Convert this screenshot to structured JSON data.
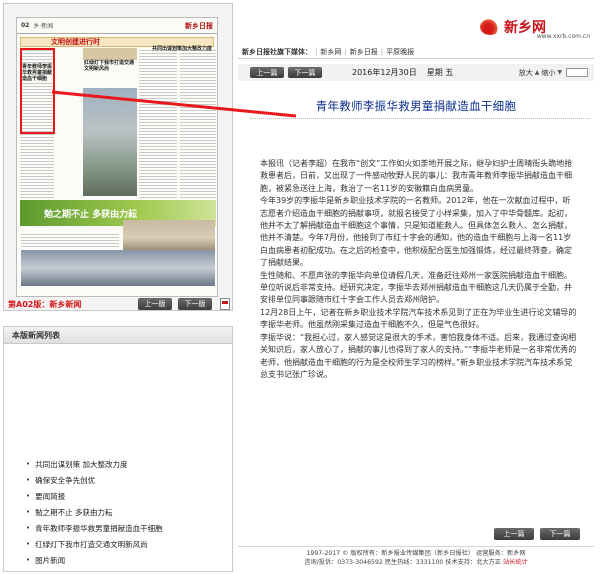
{
  "header": {
    "logo_name": "新乡网",
    "logo_url": "www.xxrb.com.cn"
  },
  "nav": {
    "lead": "新乡日报社旗下媒体：",
    "links": [
      "新乡网",
      "新乡日报",
      "平原晚报"
    ]
  },
  "toolbar": {
    "prev_label": "上一篇",
    "next_label": "下一篇",
    "date": "2016年12月30日",
    "weekday": "星期 五",
    "zoom_in": "放大",
    "zoom_out": "缩小"
  },
  "article": {
    "title": "青年教师李振华救男童捐献造血干细胞",
    "paragraphs": [
      "本报讯（记者李超）在我市“创文”工作如火如荼地开展之际，继孕妇护士周晴街头跪地抢救患者后，日前，又出现了一件感动牧野人民的事儿：我市青年教师李振华捐献造血干细胞，被紧急送往上海，救治了一名11岁的安徽籍白血病男童。",
      "今年39岁的李振华是新乡职业技术学院的一名教师。2012年，他在一次献血过程中，听志愿者介绍造血干细胞的捐献事项，就报名接受了小样采集，加入了中华骨髓库。起初，他并不太了解捐献造血干细胞这个事情，只是知道能救人。但具体怎么救人、怎么捐献，他并不清楚。今年7月份，他接到了市红十字会的通知，他的造血干细胞与上海一名11岁白血病患者初配成功。在之后的检查中，他积极配合医生加强锻炼，经过最终筛查，确定了捐献结果。",
      "生性随和、不愿声张的李振华向单位请假几天，准备赶往郑州一家医院捐献造血干细胞。单位听说后非常支持。经研究决定，李振华去郑州捐献造血干细胞这几天仍属于全勤，并安排单位同事跟随市红十字会工作人员去郑州陪护。",
      "12月28日上午，记者在新乡职业技术学院汽车技术系见到了正在为毕业生进行论文辅导的李振华老师。他虽然刚采集过造血干细胞不久，但是气色很好。",
      "李振华说：“我担心过，家人感觉这是很大的手术，害怕我身体不适。后来，我通过查询相关知识后，家人放心了，捐献的事儿也得到了家人的支持。”“李振华老师是一名非常优秀的老师，他捐献造血干细胞的行为是全校师生学习的榜样。”新乡职业技术学院汽车技术系党总支书记张广珍说。"
    ]
  },
  "paper": {
    "page_no": "02",
    "section": "乡·新闻",
    "masthead": "新乡日报",
    "banner": "文明创建进行时",
    "headline_1": "青年教师李振华救男童捐献造血干细胞",
    "headline_2": "红绿灯下我市打造交通文明新风尚",
    "headline_3": "共同出谋划策加大整改力度",
    "feature": "勉之期不止 多获由力耘"
  },
  "edition": {
    "label": "第A02版：新乡新闻",
    "prev_label": "上一版",
    "next_label": "下一版"
  },
  "news_list": {
    "title": "本版新闻列表",
    "items": [
      "共同出谋划策 加大整改力度",
      "确保安全争先创优",
      "要闻简报",
      "勉之期不止 多获由力耘",
      "青年教师李振华救男童捐献造血干细胞",
      "红绿灯下我市打造交通文明新风尚",
      "图片新闻"
    ]
  },
  "bottom_nav": {
    "prev_label": "上一篇",
    "next_label": "下一篇"
  },
  "footer": {
    "line1": "1997-2017 © 版权所有：新乡报业传媒集团（新乡日报社） 运营服务：新乡网",
    "line2": "咨询/投诉：0373-3046592 民生热线：3331100 技术支持：北大方正",
    "stats": "站长统计"
  },
  "colors": {
    "title_blue": "#0d2f8c",
    "accent_red": "#e8191d",
    "button_dark": "#4a4a4a"
  }
}
